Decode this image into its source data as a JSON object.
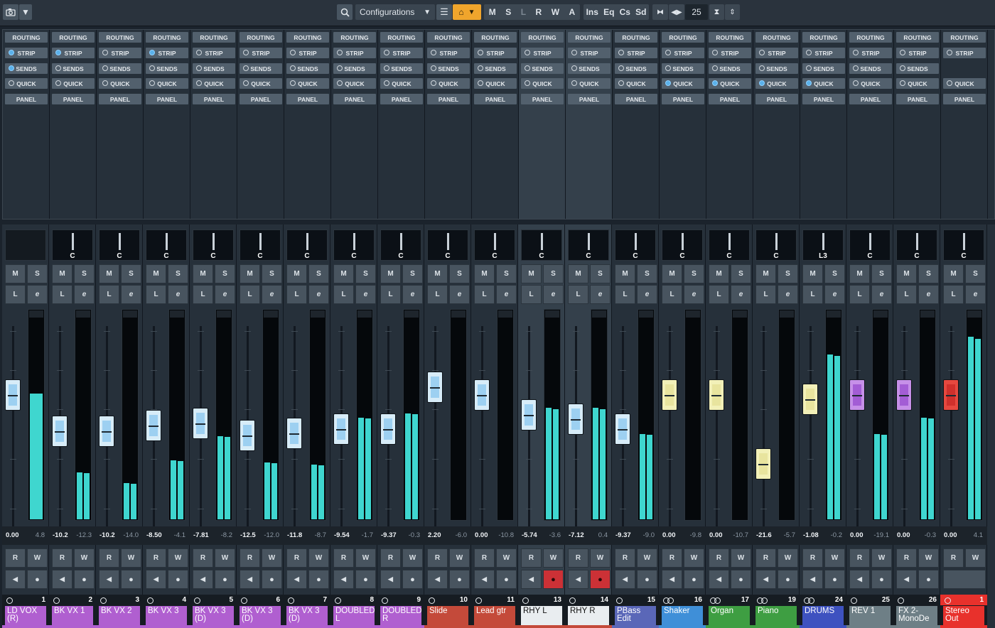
{
  "toolbar": {
    "camera_icon": "camera-icon",
    "config_label": "Configurations",
    "mode_buttons": [
      "M",
      "S",
      "L",
      "R",
      "W",
      "A"
    ],
    "view_buttons": [
      "Ins",
      "Eq",
      "Cs",
      "Sd"
    ],
    "channel_count": "25"
  },
  "rack_labels": {
    "routing": "ROUTING",
    "strip": "STRIP",
    "sends": "SENDS",
    "quick": "QUICK",
    "panel": "PANEL"
  },
  "strip_labels": {
    "mute": "M",
    "solo": "S",
    "listen": "L",
    "edit": "e",
    "read": "R",
    "write": "W"
  },
  "accent": {
    "meter": "#3fd6cf",
    "record": "#cc3136",
    "selected_bg": "#34404b",
    "stereo_out": "#e8312c"
  },
  "channels": [
    {
      "num": "1",
      "name": "LD VOX (R)",
      "pan": "",
      "volume": "0.00",
      "peak": "4.8",
      "color": "#b05fd0",
      "fader_color": "blue",
      "level": 0.66,
      "meter": 0.62,
      "strip_on": true,
      "sends_on": true,
      "quick_on": false,
      "selected": false,
      "rec": false,
      "stereo": false
    },
    {
      "num": "2",
      "name": "BK VX 1",
      "pan": "C",
      "volume": "-10.2",
      "peak": "-12.3",
      "color": "#b05fd0",
      "fader_color": "blue",
      "level": 0.48,
      "meter": 0.23,
      "strip_on": true,
      "sends_on": false,
      "quick_on": false,
      "selected": false,
      "rec": false,
      "stereo": true
    },
    {
      "num": "3",
      "name": "BK VX 2",
      "pan": "C",
      "volume": "-10.2",
      "peak": "-14.0",
      "color": "#b05fd0",
      "fader_color": "blue",
      "level": 0.48,
      "meter": 0.18,
      "strip_on": false,
      "sends_on": false,
      "quick_on": false,
      "selected": false,
      "rec": false,
      "stereo": true
    },
    {
      "num": "4",
      "name": "BK VX 3",
      "pan": "C",
      "volume": "-8.50",
      "peak": "-4.1",
      "color": "#b05fd0",
      "fader_color": "blue",
      "level": 0.51,
      "meter": 0.29,
      "strip_on": true,
      "sends_on": false,
      "quick_on": false,
      "selected": false,
      "rec": false,
      "stereo": true
    },
    {
      "num": "5",
      "name": "BK VX 3 (D)",
      "pan": "C",
      "volume": "-7.81",
      "peak": "-8.2",
      "color": "#b05fd0",
      "fader_color": "blue",
      "level": 0.52,
      "meter": 0.41,
      "strip_on": false,
      "sends_on": false,
      "quick_on": false,
      "selected": false,
      "rec": false,
      "stereo": true
    },
    {
      "num": "6",
      "name": "BK VX 3 (D)",
      "pan": "C",
      "volume": "-12.5",
      "peak": "-12.0",
      "color": "#b05fd0",
      "fader_color": "blue",
      "level": 0.46,
      "meter": 0.28,
      "strip_on": false,
      "sends_on": false,
      "quick_on": false,
      "selected": false,
      "rec": false,
      "stereo": true
    },
    {
      "num": "7",
      "name": "BK VX 3 (D)",
      "pan": "C",
      "volume": "-11.8",
      "peak": "-8.7",
      "color": "#b05fd0",
      "fader_color": "blue",
      "level": 0.47,
      "meter": 0.27,
      "strip_on": false,
      "sends_on": false,
      "quick_on": false,
      "selected": false,
      "rec": false,
      "stereo": true
    },
    {
      "num": "8",
      "name": "DOUBLED L",
      "pan": "C",
      "volume": "-9.54",
      "peak": "-1.7",
      "color": "#b05fd0",
      "fader_color": "blue",
      "level": 0.49,
      "meter": 0.5,
      "strip_on": false,
      "sends_on": false,
      "quick_on": false,
      "selected": false,
      "rec": false,
      "stereo": true
    },
    {
      "num": "9",
      "name": "DOUBLED R",
      "pan": "C",
      "volume": "-9.37",
      "peak": "-0.3",
      "color": "#b05fd0",
      "fader_color": "blue",
      "level": 0.49,
      "meter": 0.52,
      "strip_on": false,
      "sends_on": false,
      "quick_on": false,
      "selected": false,
      "rec": false,
      "stereo": true
    },
    {
      "num": "10",
      "name": "Slide",
      "pan": "C",
      "volume": "2.20",
      "peak": "-6.0",
      "color": "#c44a3a",
      "fader_color": "blue",
      "level": 0.7,
      "meter": 0.0,
      "strip_on": false,
      "sends_on": false,
      "quick_on": false,
      "selected": false,
      "rec": false,
      "stereo": true
    },
    {
      "num": "11",
      "name": "Lead gtr",
      "pan": "C",
      "volume": "0.00",
      "peak": "-10.8",
      "color": "#c44a3a",
      "fader_color": "blue",
      "level": 0.66,
      "meter": 0.0,
      "strip_on": false,
      "sends_on": false,
      "quick_on": false,
      "selected": false,
      "rec": false,
      "stereo": true
    },
    {
      "num": "13",
      "name": "RHY L",
      "pan": "C",
      "volume": "-5.74",
      "peak": "-3.6",
      "color": "#c44a3a",
      "fader_color": "blue",
      "level": 0.56,
      "meter": 0.55,
      "strip_on": false,
      "sends_on": false,
      "quick_on": false,
      "selected": true,
      "rec": true,
      "stereo": true
    },
    {
      "num": "14",
      "name": "RHY R",
      "pan": "C",
      "volume": "-7.12",
      "peak": "0.4",
      "color": "#c44a3a",
      "fader_color": "blue",
      "level": 0.54,
      "meter": 0.55,
      "strip_on": false,
      "sends_on": false,
      "quick_on": false,
      "selected": true,
      "rec": true,
      "stereo": true
    },
    {
      "num": "15",
      "name": "PBass Edit",
      "pan": "C",
      "volume": "-9.37",
      "peak": "-9.0",
      "color": "#5a67b8",
      "fader_color": "blue",
      "level": 0.49,
      "meter": 0.42,
      "strip_on": false,
      "sends_on": false,
      "quick_on": false,
      "selected": false,
      "rec": false,
      "stereo": true
    },
    {
      "num": "16",
      "name": "Shaker",
      "pan": "C",
      "volume": "0.00",
      "peak": "-9.8",
      "color": "#3f8fd8",
      "fader_color": "yellow",
      "level": 0.66,
      "meter": 0.0,
      "strip_on": false,
      "sends_on": false,
      "quick_on": true,
      "selected": false,
      "rec": false,
      "stereo": true
    },
    {
      "num": "17",
      "name": "Organ",
      "pan": "C",
      "volume": "0.00",
      "peak": "-10.7",
      "color": "#3e9e42",
      "fader_color": "yellow",
      "level": 0.66,
      "meter": 0.0,
      "strip_on": false,
      "sends_on": false,
      "quick_on": true,
      "selected": false,
      "rec": false,
      "stereo": true
    },
    {
      "num": "19",
      "name": "Piano",
      "pan": "C",
      "volume": "-21.6",
      "peak": "-5.7",
      "color": "#3e9e42",
      "fader_color": "yellow",
      "level": 0.32,
      "meter": 0.0,
      "strip_on": false,
      "sends_on": false,
      "quick_on": true,
      "selected": false,
      "rec": false,
      "stereo": true
    },
    {
      "num": "24",
      "name": "DRUMS",
      "pan": "L3",
      "volume": "-1.08",
      "peak": "-0.2",
      "color": "#3e52c0",
      "fader_color": "yellow",
      "level": 0.64,
      "meter": 0.81,
      "strip_on": false,
      "sends_on": false,
      "quick_on": true,
      "selected": false,
      "rec": false,
      "stereo": true
    },
    {
      "num": "25",
      "name": "REV 1",
      "pan": "C",
      "volume": "0.00",
      "peak": "-19.1",
      "color": "#6e7f86",
      "fader_color": "purple",
      "level": 0.66,
      "meter": 0.42,
      "strip_on": false,
      "sends_on": false,
      "quick_on": false,
      "selected": false,
      "rec": false,
      "stereo": true
    },
    {
      "num": "26",
      "name": "FX 2-MonoDe",
      "pan": "C",
      "volume": "0.00",
      "peak": "-0.3",
      "color": "#6e7f86",
      "fader_color": "purple",
      "level": 0.66,
      "meter": 0.5,
      "strip_on": false,
      "sends_on": false,
      "quick_on": false,
      "selected": false,
      "rec": false,
      "stereo": true
    },
    {
      "num": "1",
      "name": "Stereo Out",
      "pan": "C",
      "volume": "0.00",
      "peak": "4.1",
      "color": "#e8312c",
      "fader_color": "red",
      "level": 0.66,
      "meter": 0.9,
      "strip_on": false,
      "sends_on": false,
      "quick_on": false,
      "selected": false,
      "rec": false,
      "stereo": true
    }
  ]
}
